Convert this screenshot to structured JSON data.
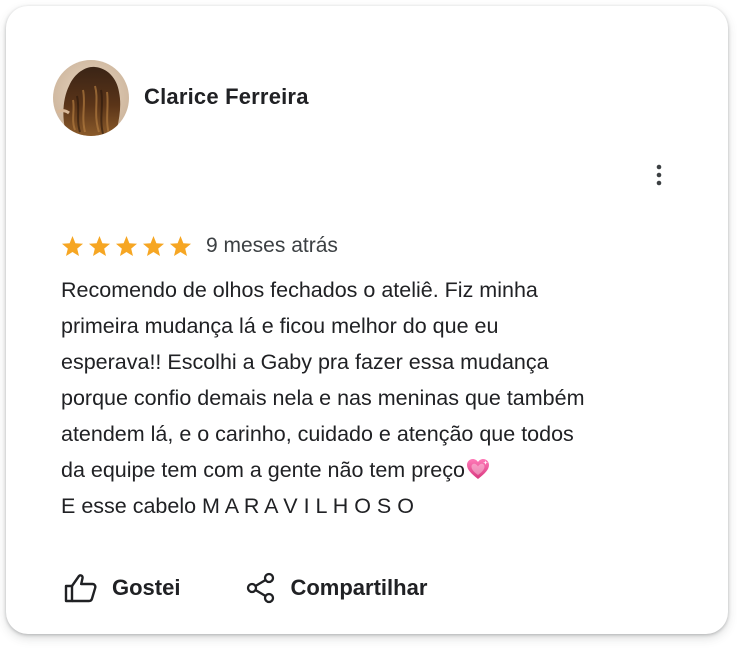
{
  "review": {
    "author_name": "Clarice Ferreira",
    "rating": 5,
    "rating_max": 5,
    "date": "9 meses atrás",
    "text_lines": [
      "Recomendo de olhos fechados o ateliê. Fiz minha",
      "primeira mudança lá e ficou melhor do que eu",
      "esperava!! Escolhi a Gaby pra fazer essa mudança",
      "porque confio demais nela e nas meninas que também",
      "atendem lá, e o carinho, cuidado e atenção que todos",
      "da equipe tem com a gente não tem preço",
      "E esse cabelo M A R A V I L H O S O"
    ],
    "emoji": "heart-emoji"
  },
  "actions": {
    "like_label": "Gostei",
    "share_label": "Compartilhar"
  },
  "icons": {
    "more": "more-vertical-icon",
    "like": "thumbs-up-icon",
    "share": "share-icon",
    "star": "star-icon"
  },
  "colors": {
    "star": "#F6A623",
    "text": "#202124",
    "secondary_text": "#3C4043",
    "heart": "#E8569A"
  }
}
